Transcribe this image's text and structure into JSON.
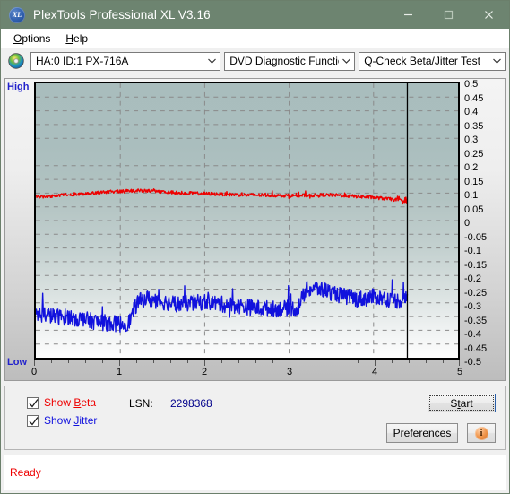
{
  "window": {
    "title": "PlexTools Professional XL V3.16",
    "logo_text": "XL",
    "minimize_icon": "minimize-icon",
    "maximize_icon": "maximize-icon",
    "close_icon": "close-icon",
    "titlebar_color": "#6d8470"
  },
  "menu": {
    "items": [
      {
        "label": "Options",
        "accel": "O"
      },
      {
        "label": "Help",
        "accel": "H"
      }
    ]
  },
  "toolbar": {
    "disc_icon": "disc-icon",
    "drive_select": {
      "value": "HA:0 ID:1  PX-716A",
      "arrow_icon": "chevron-down-icon"
    },
    "function_select": {
      "value": "DVD Diagnostic Functions",
      "arrow_icon": "chevron-down-icon"
    },
    "test_select": {
      "value": "Q-Check Beta/Jitter Test",
      "arrow_icon": "chevron-down-icon"
    }
  },
  "chart_labels": {
    "high": "High",
    "low": "Low"
  },
  "controls": {
    "show_beta": {
      "label_prefix": "Show ",
      "label_accel": "B",
      "label_suffix": "eta",
      "checked": true,
      "color": "#ee0000"
    },
    "show_jitter": {
      "label_prefix": "Show ",
      "label_accel": "J",
      "label_suffix": "itter",
      "checked": true,
      "color": "#1111dd"
    },
    "lsn_label": "LSN:",
    "lsn_value": "2298368",
    "start_button": {
      "prefix": "S",
      "accel": "t",
      "suffix": "art",
      "full": "Start"
    },
    "preferences_button": {
      "prefix": "",
      "accel": "P",
      "suffix": "references",
      "full": "Preferences"
    },
    "info_button": {
      "icon": "info-icon",
      "glyph": "i"
    }
  },
  "status": {
    "text": "Ready",
    "color": "#ee0000"
  },
  "chart_data": {
    "type": "line",
    "title": "Q-Check Beta/Jitter Test",
    "xlabel": "",
    "ylabel": "",
    "xlim": [
      0,
      5
    ],
    "ylim": [
      -0.5,
      0.5
    ],
    "grid": true,
    "legend_position": "bottom-left",
    "x_ticks": [
      0,
      1,
      2,
      3,
      4,
      5
    ],
    "x_minor_step": 0.2,
    "y_ticks": [
      0.5,
      0.45,
      0.4,
      0.35,
      0.3,
      0.25,
      0.2,
      0.15,
      0.1,
      0.05,
      0,
      -0.05,
      -0.1,
      -0.15,
      -0.2,
      -0.25,
      -0.3,
      -0.35,
      -0.4,
      -0.45,
      -0.5
    ],
    "y_axis_top_label": "High",
    "y_axis_bottom_label": "Low",
    "cursor_x": 4.4,
    "data_end_x": 4.4,
    "series": [
      {
        "name": "Beta",
        "color": "#ee0000",
        "noise": 0.006,
        "x": [
          0.0,
          0.1,
          0.2,
          0.3,
          0.4,
          0.5,
          0.6,
          0.7,
          0.8,
          0.9,
          1.0,
          1.1,
          1.2,
          1.3,
          1.4,
          1.5,
          1.6,
          1.7,
          1.8,
          1.9,
          2.0,
          2.1,
          2.2,
          2.3,
          2.4,
          2.5,
          2.6,
          2.7,
          2.8,
          2.9,
          3.0,
          3.1,
          3.2,
          3.3,
          3.4,
          3.5,
          3.6,
          3.7,
          3.8,
          3.9,
          4.0,
          4.1,
          4.2,
          4.3,
          4.4
        ],
        "values": [
          0.088,
          0.086,
          0.09,
          0.093,
          0.095,
          0.097,
          0.099,
          0.101,
          0.103,
          0.105,
          0.107,
          0.108,
          0.109,
          0.108,
          0.107,
          0.105,
          0.103,
          0.101,
          0.1,
          0.099,
          0.098,
          0.097,
          0.096,
          0.095,
          0.094,
          0.093,
          0.093,
          0.092,
          0.092,
          0.091,
          0.091,
          0.091,
          0.091,
          0.092,
          0.093,
          0.093,
          0.092,
          0.09,
          0.088,
          0.086,
          0.084,
          0.081,
          0.078,
          0.074,
          0.07
        ]
      },
      {
        "name": "Jitter",
        "color": "#1111dd",
        "noise": 0.03,
        "x": [
          0.0,
          0.1,
          0.2,
          0.3,
          0.4,
          0.5,
          0.6,
          0.7,
          0.8,
          0.9,
          1.0,
          1.1,
          1.2,
          1.3,
          1.4,
          1.5,
          1.6,
          1.7,
          1.8,
          1.9,
          2.0,
          2.1,
          2.2,
          2.3,
          2.4,
          2.5,
          2.6,
          2.7,
          2.8,
          2.9,
          3.0,
          3.1,
          3.2,
          3.3,
          3.4,
          3.5,
          3.6,
          3.7,
          3.8,
          3.9,
          4.0,
          4.1,
          4.2,
          4.3,
          4.4
        ],
        "values": [
          -0.345,
          -0.34,
          -0.348,
          -0.352,
          -0.35,
          -0.358,
          -0.362,
          -0.368,
          -0.372,
          -0.375,
          -0.378,
          -0.372,
          -0.3,
          -0.282,
          -0.292,
          -0.296,
          -0.3,
          -0.305,
          -0.302,
          -0.3,
          -0.296,
          -0.3,
          -0.305,
          -0.308,
          -0.31,
          -0.315,
          -0.318,
          -0.32,
          -0.322,
          -0.322,
          -0.32,
          -0.322,
          -0.252,
          -0.248,
          -0.252,
          -0.262,
          -0.272,
          -0.28,
          -0.286,
          -0.284,
          -0.278,
          -0.282,
          -0.288,
          -0.292,
          -0.286
        ]
      }
    ]
  }
}
